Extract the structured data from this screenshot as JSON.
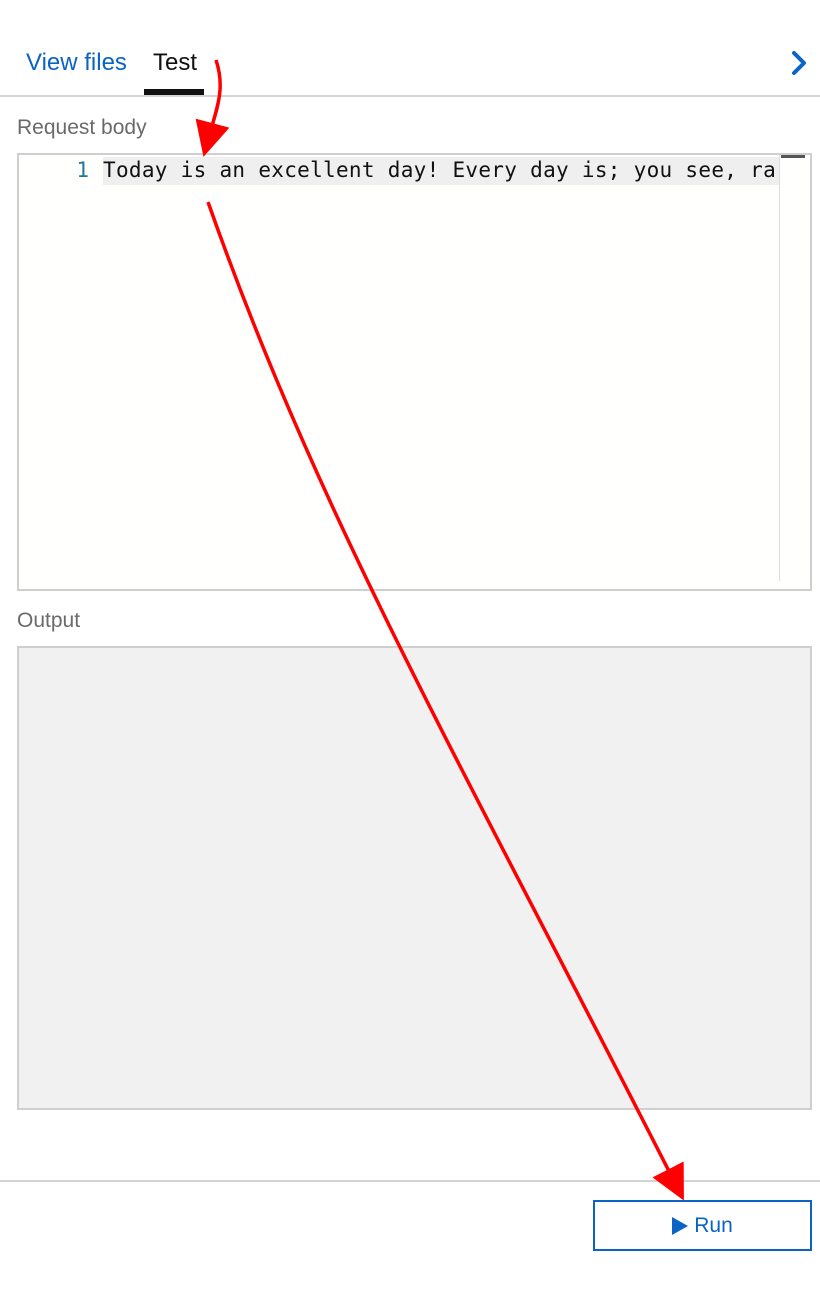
{
  "tabs": [
    {
      "label": "View files",
      "active": false
    },
    {
      "label": "Test",
      "active": true
    }
  ],
  "header": {
    "expand_icon": "chevron-right-icon"
  },
  "request_body": {
    "label": "Request body",
    "line_numbers": [
      "1"
    ],
    "lines": [
      "Today is an excellent day! Every day is; you see, ra"
    ]
  },
  "output": {
    "label": "Output",
    "content": ""
  },
  "footer": {
    "run_label": "Run",
    "run_icon": "play-icon"
  },
  "colors": {
    "accent": "#0b63c5",
    "annotation_arrow": "#ff0000"
  }
}
